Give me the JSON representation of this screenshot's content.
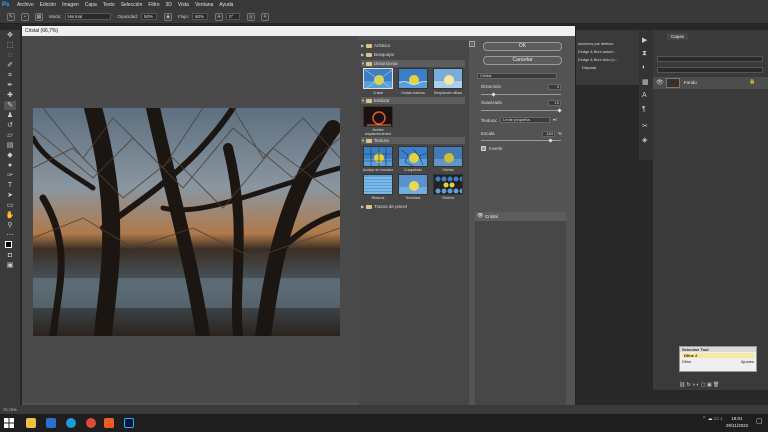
{
  "app": {
    "logo": "Ps",
    "menu": [
      "Archivo",
      "Edición",
      "Imagen",
      "Capa",
      "Texto",
      "Selección",
      "Filtro",
      "3D",
      "Vista",
      "Ventana",
      "Ayuda"
    ]
  },
  "options_bar": {
    "mode_label": "Modo:",
    "mode_value": "Normal",
    "opacity_label": "Opacidad:",
    "opacity_value": "50%",
    "flow_label": "Flujo:",
    "flow_value": "60%",
    "angle_value": "0°"
  },
  "dialog": {
    "title": "Cristal (66,7%)",
    "zoom_value": "66,7%",
    "ok_label": "OK",
    "cancel_label": "Cancelar"
  },
  "filter_gallery": {
    "categories": {
      "artistic": "Artístico",
      "sketch": "Bosquejar",
      "distort": "Distorsionar",
      "stylize": "Estilizar",
      "texture": "Textura",
      "brush": "Trazos de pincel"
    },
    "distort_filters": [
      "Cristal",
      "Ondas marinas",
      "Resplandor difuso"
    ],
    "stylize_filters": [
      "Bordes resplandecientes"
    ],
    "texture_filters": [
      "Azulejo de mosaico",
      "Craquelado",
      "Grietas",
      "Retazos",
      "Texturizar",
      "Vidriera"
    ]
  },
  "settings": {
    "filter_select": "Cristal",
    "distortion_label": "Distorsión",
    "distortion_value": "3",
    "smoothness_label": "Suavizado",
    "smoothness_value": "15",
    "texture_label": "Textura:",
    "texture_value": "Lente pequeña",
    "scale_label": "Escala",
    "scale_value": "184",
    "scale_unit": "%",
    "invert_label": "Invertir",
    "effect_layer": "Cristal"
  },
  "right_dock": {
    "actions": [
      "Acciones por defecto",
      "Dodge & Burn autom...",
      "Dodge & Burn Auto [u...",
      "Disparar"
    ],
    "layers_tab": "Capas",
    "layer_name": "Fondo"
  },
  "selective_tool": {
    "title": "Selective Tool",
    "item": "Dfine 2",
    "item2": "Dfine",
    "settings": "Ajustes"
  },
  "status": {
    "zoom": "75,76%"
  },
  "taskbar": {
    "time": "18:01",
    "date": "29/11/2022"
  },
  "colors": {
    "ps_blue": "#31a8ff",
    "dialog_bg": "#535353"
  }
}
